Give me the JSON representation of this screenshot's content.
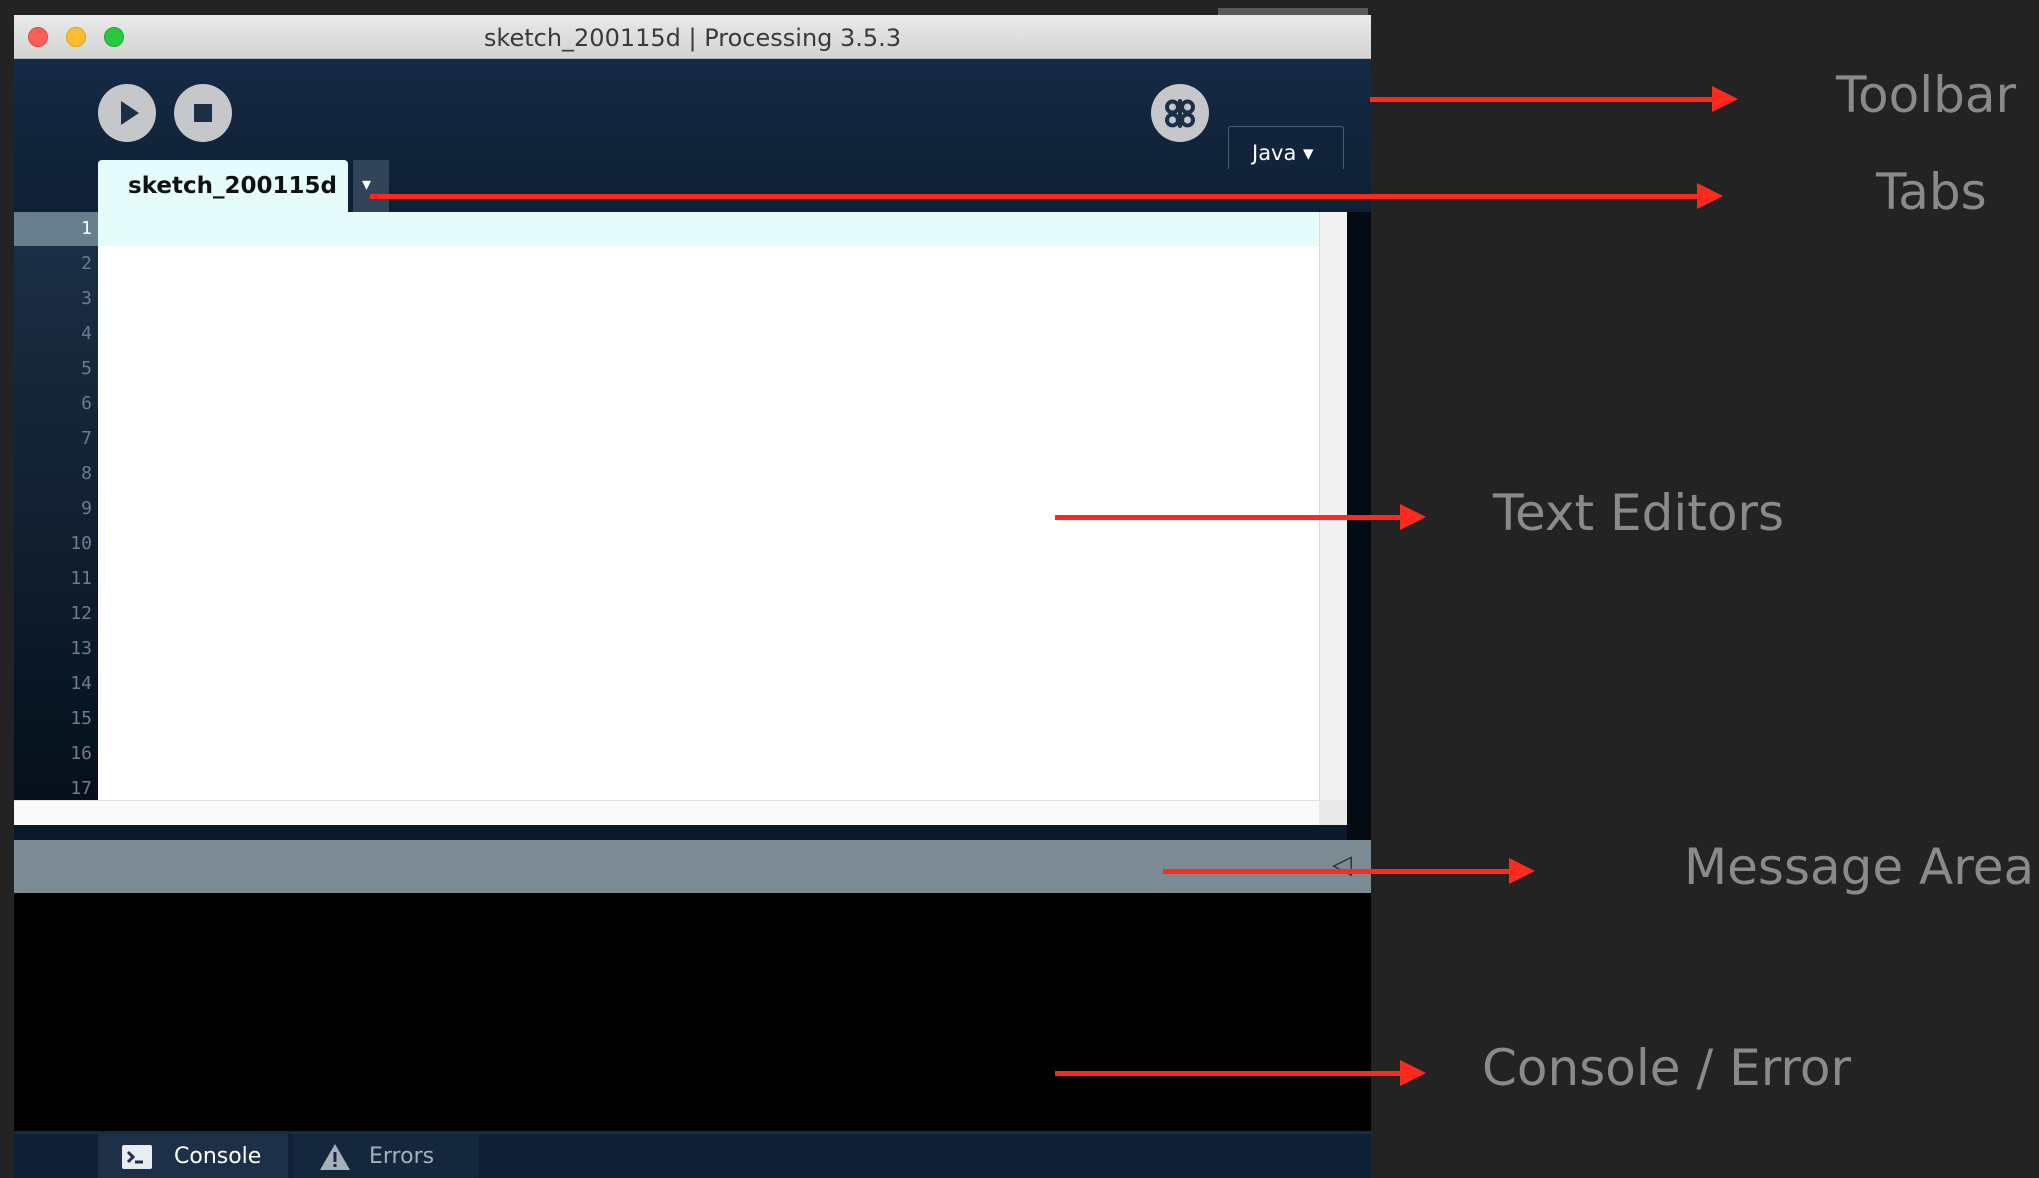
{
  "window": {
    "title": "sketch_200115d | Processing 3.5.3"
  },
  "toolbar": {
    "run_icon": "play-icon",
    "stop_icon": "stop-icon",
    "debug_icon": "butterfly-icon",
    "mode_label": "Java ▾"
  },
  "tabs": [
    {
      "label": "sketch_200115d",
      "active": true
    }
  ],
  "tab_menu_glyph": "▾",
  "editor": {
    "line_numbers": [
      "1",
      "2",
      "3",
      "4",
      "5",
      "6",
      "7",
      "8",
      "9",
      "10",
      "11",
      "12",
      "13",
      "14",
      "15",
      "16",
      "17"
    ],
    "current_line": 1
  },
  "message_area": {
    "collapse_glyph": "◁"
  },
  "footer": {
    "console_label": "Console",
    "errors_label": "Errors"
  },
  "annotations": {
    "toolbar": "Toolbar",
    "tabs": "Tabs",
    "text_editors": "Text Editors",
    "message_area": "Message Area",
    "console_error": "Console / Error"
  },
  "colors": {
    "arrow": "#ff2a1b",
    "annotation_text": "#8a8a8a",
    "background": "#232323",
    "editor_highlight": "#e6fcfb",
    "toolbar_bg": "#152a46"
  }
}
